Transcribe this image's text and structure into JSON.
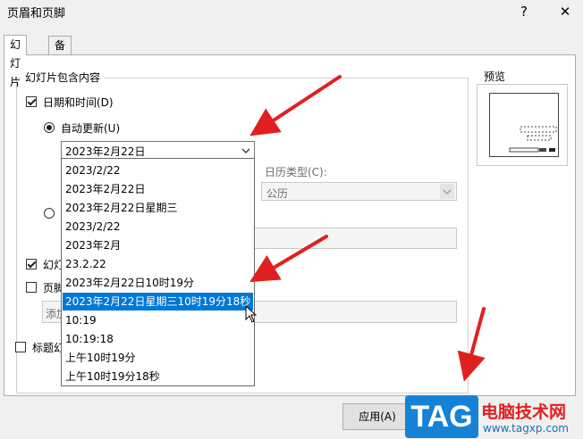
{
  "window": {
    "title": "页眉和页脚",
    "help_label": "?",
    "close_label": "✕"
  },
  "tabs": [
    {
      "label": "幻灯片",
      "active": true
    },
    {
      "label": "备注和讲义",
      "active": false
    }
  ],
  "group": {
    "title": "幻灯片包含内容"
  },
  "datetime": {
    "label": "日期和时间(D)",
    "checked": true,
    "auto_update_label": "自动更新(U)",
    "auto_update_selected": true,
    "selected_format": "2023年2月22日",
    "calendar_label": "日历类型(C):",
    "calendar_value": "公历"
  },
  "dropdown_items": [
    "2023/2/22",
    "2023年2月22日",
    "2023年2月22日星期三",
    "2023/2/22",
    "2023年2月",
    "23.2.22",
    "2023年2月22日10时19分",
    "2023年2月22日星期三10时19分18秒",
    "10:19",
    "10:19:18",
    "上午10时19分",
    "上午10时19分18秒"
  ],
  "dropdown_selected_index": 7,
  "slide_number": {
    "label_partial": "幻灯",
    "checked": true
  },
  "footer": {
    "label_partial": "页脚",
    "checked": false,
    "placeholder_partial": "添加"
  },
  "title_slide": {
    "label_partial": "标题幻",
    "checked": false
  },
  "preview": {
    "label": "预览"
  },
  "buttons": {
    "apply": "应用(A)"
  },
  "watermark": {
    "logo_text": "TAG",
    "site_name": "电脑技术网",
    "site_url": "www.tagxp.com"
  },
  "colors": {
    "accent": "#0078d7",
    "arrow": "#e02020",
    "logo_bg": "#1582d6",
    "site_name": "#e02020"
  }
}
